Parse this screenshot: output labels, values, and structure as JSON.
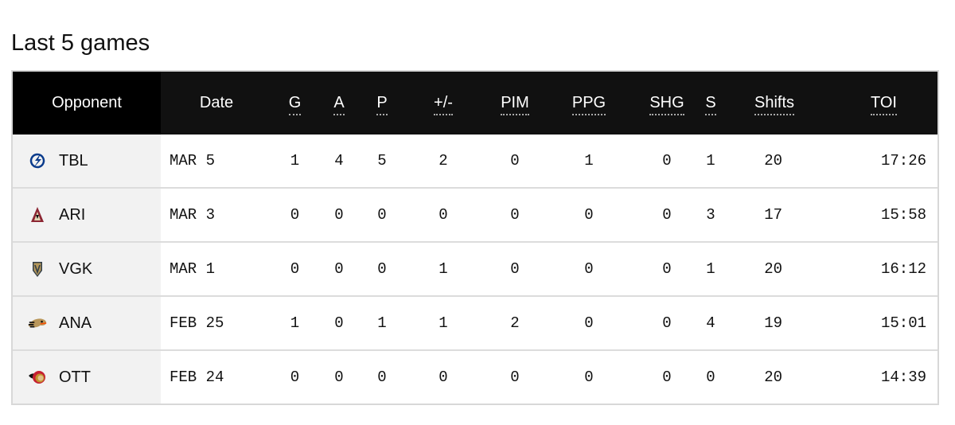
{
  "title": "Last 5 games",
  "columns": {
    "opponent": "Opponent",
    "date": "Date",
    "g": "G",
    "a": "A",
    "p": "P",
    "pm": "+/-",
    "pim": "PIM",
    "ppg": "PPG",
    "shg": "SHG",
    "s": "S",
    "shifts": "Shifts",
    "toi": "TOI"
  },
  "rows": [
    {
      "team": "TBL",
      "logo": "lightning-logo-icon",
      "date": "MAR 5",
      "g": "1",
      "a": "4",
      "p": "5",
      "pm": "2",
      "pim": "0",
      "ppg": "1",
      "shg": "0",
      "s": "1",
      "shifts": "20",
      "toi": "17:26"
    },
    {
      "team": "ARI",
      "logo": "coyotes-logo-icon",
      "date": "MAR 3",
      "g": "0",
      "a": "0",
      "p": "0",
      "pm": "0",
      "pim": "0",
      "ppg": "0",
      "shg": "0",
      "s": "3",
      "shifts": "17",
      "toi": "15:58"
    },
    {
      "team": "VGK",
      "logo": "golden-knights-logo-icon",
      "date": "MAR 1",
      "g": "0",
      "a": "0",
      "p": "0",
      "pm": "1",
      "pim": "0",
      "ppg": "0",
      "shg": "0",
      "s": "1",
      "shifts": "20",
      "toi": "16:12"
    },
    {
      "team": "ANA",
      "logo": "ducks-logo-icon",
      "date": "FEB 25",
      "g": "1",
      "a": "0",
      "p": "1",
      "pm": "1",
      "pim": "2",
      "ppg": "0",
      "shg": "0",
      "s": "4",
      "shifts": "19",
      "toi": "15:01"
    },
    {
      "team": "OTT",
      "logo": "senators-logo-icon",
      "date": "FEB 24",
      "g": "0",
      "a": "0",
      "p": "0",
      "pm": "0",
      "pim": "0",
      "ppg": "0",
      "shg": "0",
      "s": "0",
      "shifts": "20",
      "toi": "14:39"
    }
  ]
}
